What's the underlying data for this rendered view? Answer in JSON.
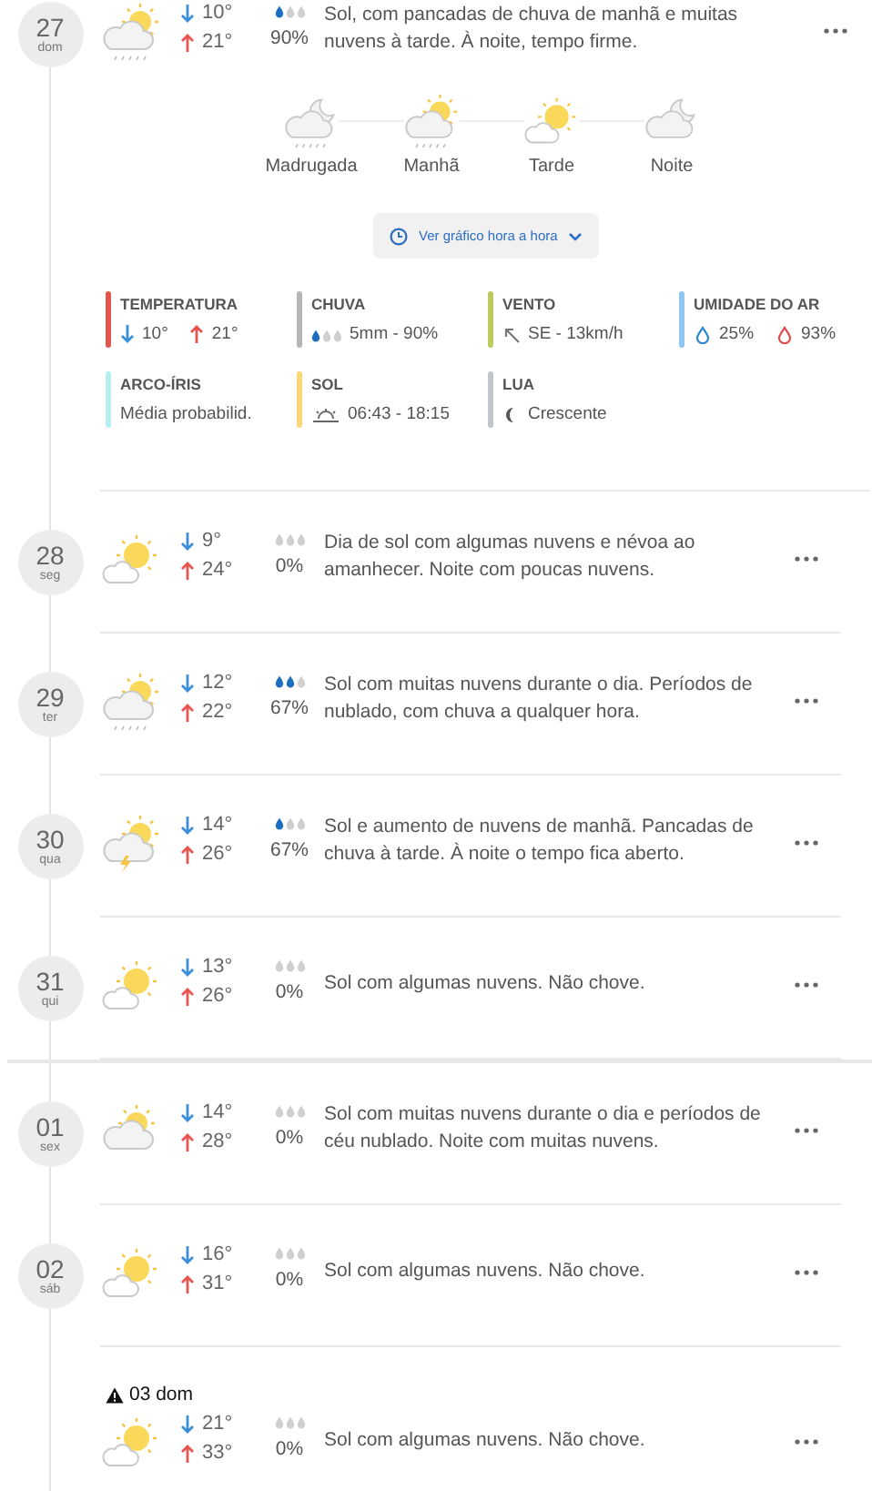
{
  "days": [
    {
      "day": "27",
      "weekday": "dom",
      "kind": "sun-cloud-rain",
      "low": "10°",
      "high": "21°",
      "drops": [
        {
          "filled": true
        },
        {
          "filled": false
        },
        {
          "filled": false
        }
      ],
      "rain": "90%",
      "description": "Sol, com pancadas de chuva de manhã e muitas nuvens à tarde. À noite, tempo firme.",
      "expanded": true,
      "new_week": false,
      "detail": {
        "periods": [
          {
            "kind": "moon-cloud-rain",
            "label": "Madrugada"
          },
          {
            "kind": "sun-cloud-rain",
            "label": "Manhã"
          },
          {
            "kind": "sun-cloud",
            "label": "Tarde"
          },
          {
            "kind": "moon-cloud",
            "label": "Noite"
          }
        ],
        "chart_button": "Ver gráfico hora a hora",
        "stats": [
          {
            "kind": "temperature",
            "title": "TEMPERATURA",
            "color": "#e0574f",
            "low": "10°",
            "high": "21°"
          },
          {
            "kind": "rain",
            "title": "CHUVA",
            "color": "#b5b5b5",
            "drops": [
              {
                "filled": true
              },
              {
                "filled": false
              },
              {
                "filled": false
              }
            ],
            "value": "5mm - 90%"
          },
          {
            "kind": "wind",
            "title": "VENTO",
            "color": "#bccb5c",
            "value": "SE - 13km/h"
          },
          {
            "kind": "humidity",
            "title": "UMIDADE DO AR",
            "color": "#8fc6f2",
            "min": "25%",
            "max": "93%"
          },
          {
            "kind": "text",
            "title": "ARCO-ÍRIS",
            "color": "#b6eff1",
            "value": "Média probabilid."
          },
          {
            "kind": "sun",
            "title": "SOL",
            "color": "#f8d878",
            "value": "06:43 - 18:15"
          },
          {
            "kind": "moon",
            "title": "LUA",
            "color": "#c1c6cc",
            "value": "Crescente"
          }
        ]
      }
    },
    {
      "day": "28",
      "weekday": "seg",
      "kind": "sun-cloud",
      "low": "9°",
      "high": "24°",
      "drops": [
        {
          "filled": false
        },
        {
          "filled": false
        },
        {
          "filled": false
        }
      ],
      "rain": "0%",
      "description": "Dia de sol com algumas nuvens e névoa ao amanhecer. Noite com poucas nuvens.",
      "expanded": false,
      "new_week": false
    },
    {
      "day": "29",
      "weekday": "ter",
      "kind": "sun-cloud-rain",
      "low": "12°",
      "high": "22°",
      "drops": [
        {
          "filled": true
        },
        {
          "filled": true
        },
        {
          "filled": false
        }
      ],
      "rain": "67%",
      "description": "Sol com muitas nuvens durante o dia. Períodos de nublado, com chuva a qualquer hora.",
      "expanded": false,
      "new_week": false
    },
    {
      "day": "30",
      "weekday": "qua",
      "kind": "sun-cloud-storm",
      "low": "14°",
      "high": "26°",
      "drops": [
        {
          "filled": true
        },
        {
          "filled": false
        },
        {
          "filled": false
        }
      ],
      "rain": "67%",
      "description": "Sol e aumento de nuvens de manhã. Pancadas de chuva à tarde. À noite o tempo fica aberto.",
      "expanded": false,
      "new_week": false
    },
    {
      "day": "31",
      "weekday": "qui",
      "kind": "sun-cloud",
      "low": "13°",
      "high": "26°",
      "drops": [
        {
          "filled": false
        },
        {
          "filled": false
        },
        {
          "filled": false
        }
      ],
      "rain": "0%",
      "description": "Sol com algumas nuvens. Não chove.",
      "expanded": false,
      "new_week": false
    },
    {
      "day": "01",
      "weekday": "sex",
      "kind": "sun-big-cloud",
      "low": "14°",
      "high": "28°",
      "drops": [
        {
          "filled": false
        },
        {
          "filled": false
        },
        {
          "filled": false
        }
      ],
      "rain": "0%",
      "description": "Sol com muitas nuvens durante o dia e períodos de céu nublado. Noite com muitas nuvens.",
      "expanded": false,
      "new_week": true
    },
    {
      "day": "02",
      "weekday": "sáb",
      "kind": "sun-cloud",
      "low": "16°",
      "high": "31°",
      "drops": [
        {
          "filled": false
        },
        {
          "filled": false
        },
        {
          "filled": false
        }
      ],
      "rain": "0%",
      "description": "Sol com algumas nuvens. Não chove.",
      "expanded": false,
      "new_week": false
    },
    {
      "alert": true,
      "label": "03 dom",
      "kind": "sun-cloud",
      "low": "21°",
      "high": "33°",
      "drops": [
        {
          "filled": false
        },
        {
          "filled": false
        },
        {
          "filled": false
        }
      ],
      "rain": "0%",
      "description": "Sol com algumas nuvens. Não chove.",
      "expanded": false,
      "new_week": false
    }
  ]
}
